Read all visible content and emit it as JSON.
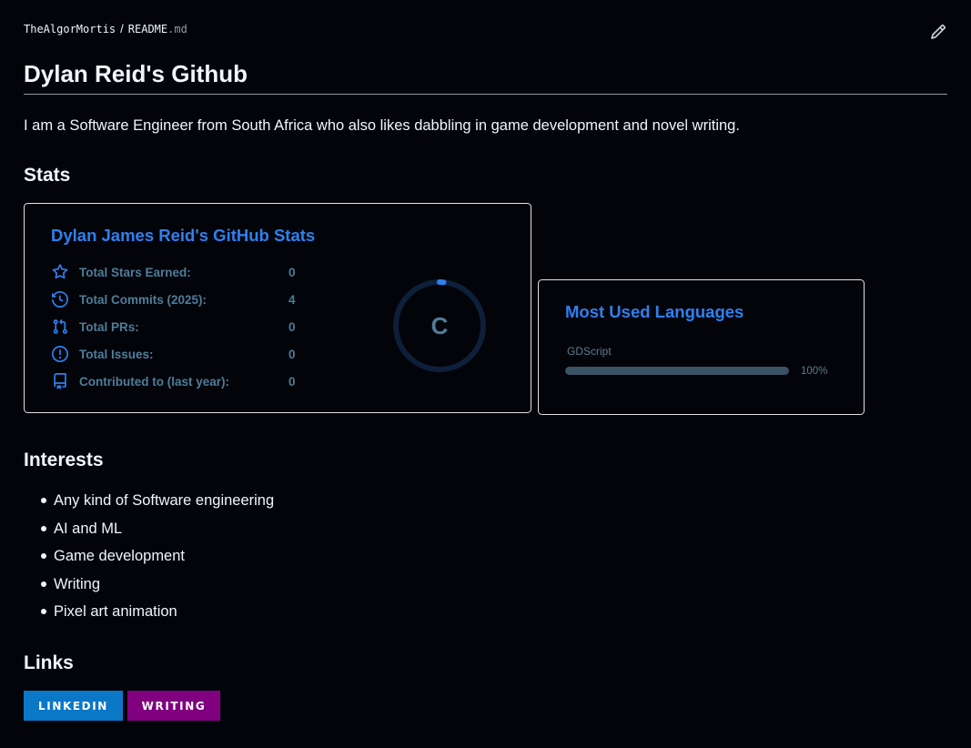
{
  "breadcrumb": {
    "owner": "TheAlgorMortis",
    "separator": "/",
    "file_base": "README",
    "file_ext": ".md"
  },
  "heading": {
    "title": "Dylan Reid's Github",
    "intro": "I am a Software Engineer from South Africa who also likes dabbling in game development and novel writing."
  },
  "sections": {
    "stats": "Stats",
    "interests": "Interests",
    "links": "Links"
  },
  "stats_card": {
    "title": "Dylan James Reid's GitHub Stats",
    "rows": [
      {
        "icon": "star-icon",
        "label": "Total Stars Earned:",
        "value": "0"
      },
      {
        "icon": "history-icon",
        "label": "Total Commits (2025):",
        "value": "4"
      },
      {
        "icon": "pull-request-icon",
        "label": "Total PRs:",
        "value": "0"
      },
      {
        "icon": "issue-icon",
        "label": "Total Issues:",
        "value": "0"
      },
      {
        "icon": "repo-icon",
        "label": "Contributed to (last year):",
        "value": "0"
      }
    ],
    "rank": "C",
    "rank_progress_pct": 3
  },
  "languages_card": {
    "title": "Most Used Languages",
    "languages": [
      {
        "name": "GDScript",
        "percent_label": "100%",
        "percent": 100
      }
    ]
  },
  "interests": [
    "Any kind of Software engineering",
    "AI and ML",
    "Game development",
    "Writing",
    "Pixel art animation"
  ],
  "links": [
    {
      "label": "LINKEDIN",
      "color": "#0a77c7"
    },
    {
      "label": "WRITING",
      "color": "#800080"
    }
  ],
  "colors": {
    "background": "#02040a",
    "text": "#f0f6fc",
    "card_title": "#2f80ed",
    "card_text": "#4f7d99",
    "card_border": "#e4e2e2"
  },
  "icons": {
    "edit": "pencil-icon"
  }
}
